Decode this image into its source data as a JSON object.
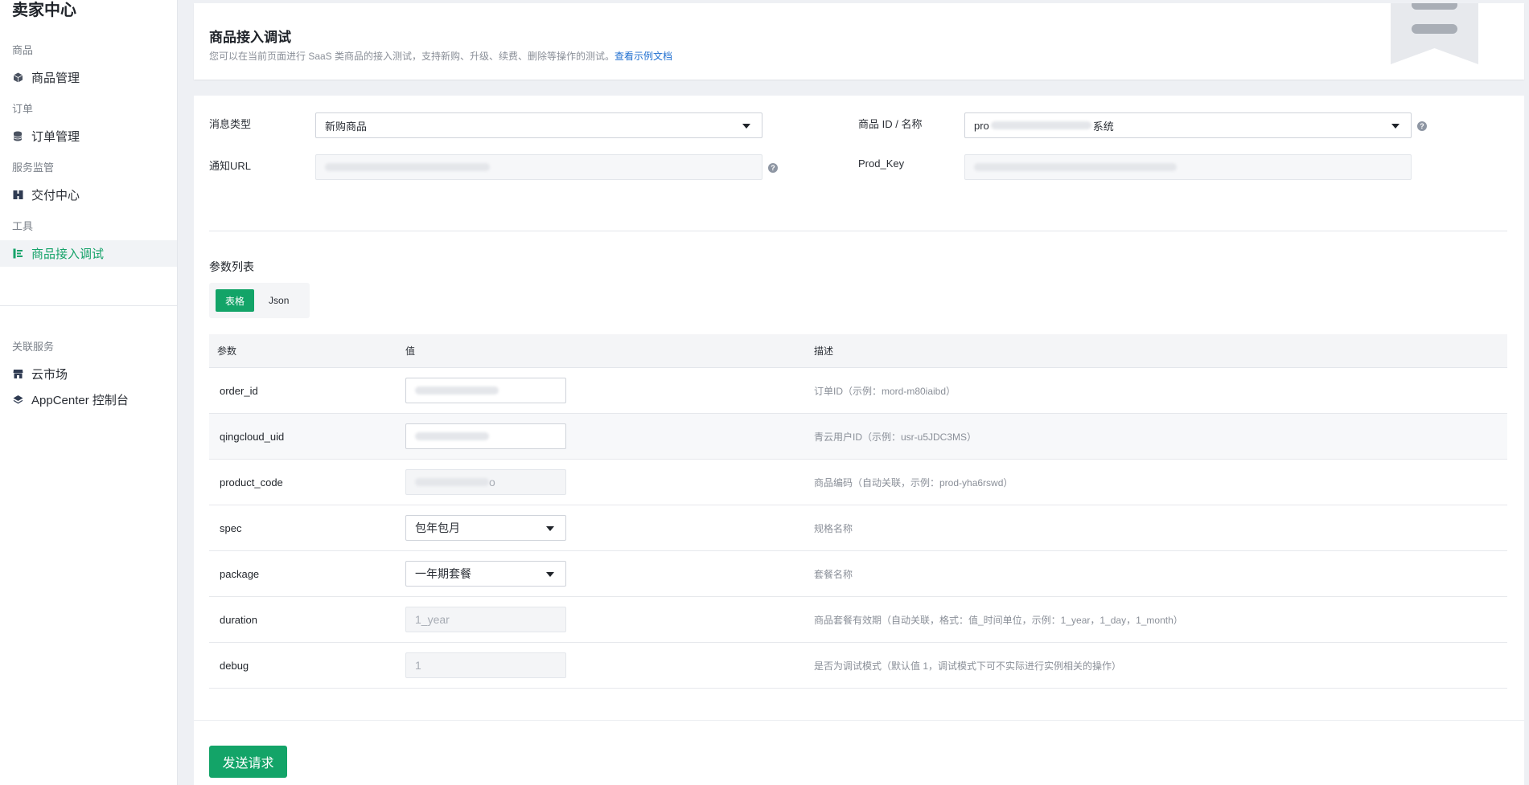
{
  "sidebar": {
    "app_title": "卖家中心",
    "groups": {
      "goods": "商品",
      "orders": "订单",
      "service": "服务监管",
      "tools": "工具",
      "related": "关联服务"
    },
    "items": {
      "goods_mgmt": "商品管理",
      "order_mgmt": "订单管理",
      "delivery": "交付中心",
      "debug": "商品接入调试",
      "market": "云市场",
      "appcenter": "AppCenter 控制台"
    }
  },
  "header": {
    "title": "商品接入调试",
    "desc": "您可以在当前页面进行 SaaS 类商品的接入测试，支持新购、升级、续费、删除等操作的测试。",
    "link": "查看示例文档"
  },
  "form": {
    "msg_type_label": "消息类型",
    "msg_type_value": "新购商品",
    "notify_url_label": "通知URL",
    "product_label": "商品 ID / 名称",
    "product_value_prefix": "pro",
    "product_value_suffix": "系统",
    "prod_key_label": "Prod_Key",
    "help_glyph": "?"
  },
  "params": {
    "title": "参数列表",
    "tab_table": "表格",
    "tab_json": "Json",
    "headers": {
      "param": "参数",
      "value": "值",
      "desc": "描述"
    },
    "rows": [
      {
        "param": "order_id",
        "desc": "订单ID（示例：mord-m80iaibd）"
      },
      {
        "param": "qingcloud_uid",
        "desc": "青云用户ID（示例：usr-u5JDC3MS）"
      },
      {
        "param": "product_code",
        "value_suffix": "o",
        "desc": "商品编码（自动关联，示例：prod-yha6rswd）"
      },
      {
        "param": "spec",
        "value": "包年包月",
        "desc": "规格名称"
      },
      {
        "param": "package",
        "value": "一年期套餐",
        "desc": "套餐名称"
      },
      {
        "param": "duration",
        "value": "1_year",
        "desc": "商品套餐有效期（自动关联，格式：值_时间单位，示例：1_year，1_day，1_month）"
      },
      {
        "param": "debug",
        "value": "1",
        "desc": "是否为调试模式（默认值 1，调试模式下可不实际进行实例相关的操作）"
      }
    ]
  },
  "footer": {
    "send_label": "发送请求"
  },
  "colors": {
    "accent": "#13a468",
    "link": "#1f6fd0"
  },
  "icons": [
    "cube-icon",
    "database-icon",
    "delivery-icon",
    "debug-tool-icon",
    "store-icon",
    "layers-icon",
    "chevron-down-icon",
    "help-icon",
    "bookmark-icon"
  ]
}
